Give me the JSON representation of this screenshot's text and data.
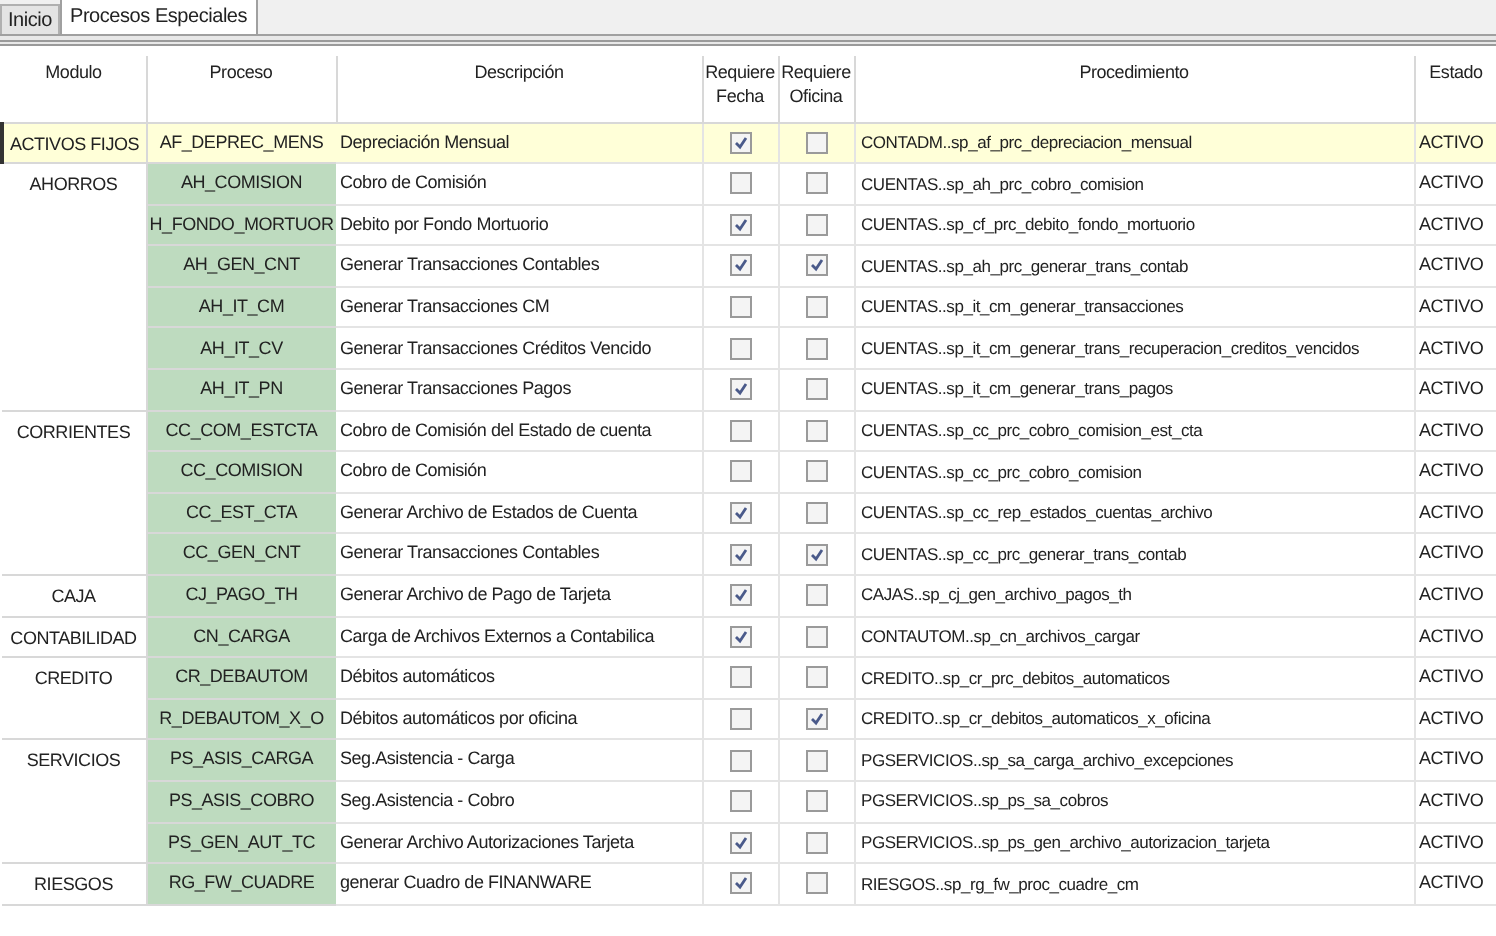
{
  "tabs": [
    {
      "label": "Inicio",
      "selected": false
    },
    {
      "label": "Procesos Especiales",
      "selected": true
    }
  ],
  "table": {
    "columns": [
      "Modulo",
      "Proceso",
      "Descripción",
      "Requiere Fecha",
      "Requiere Oficina",
      "Procedimiento",
      "Estado"
    ],
    "groups": [
      {
        "modulo": "ACTIVOS FIJOS",
        "rows": [
          {
            "proceso": "AF_DEPREC_MENS",
            "descripcion": "Depreciación Mensual",
            "fecha": true,
            "oficina": false,
            "procedimiento": "CONTADM..sp_af_prc_depreciacion_mensual",
            "estado": "ACTIVO",
            "selected": true
          }
        ]
      },
      {
        "modulo": "AHORROS",
        "rows": [
          {
            "proceso": "AH_COMISION",
            "descripcion": "Cobro de Comisión",
            "fecha": false,
            "oficina": false,
            "procedimiento": "CUENTAS..sp_ah_prc_cobro_comision",
            "estado": "ACTIVO",
            "selected": false
          },
          {
            "proceso": "H_FONDO_MORTUOR",
            "descripcion": "Debito por Fondo Mortuorio",
            "fecha": true,
            "oficina": false,
            "procedimiento": "CUENTAS..sp_cf_prc_debito_fondo_mortuorio",
            "estado": "ACTIVO",
            "selected": false
          },
          {
            "proceso": "AH_GEN_CNT",
            "descripcion": "Generar Transacciones Contables",
            "fecha": true,
            "oficina": true,
            "procedimiento": "CUENTAS..sp_ah_prc_generar_trans_contab",
            "estado": "ACTIVO",
            "selected": false
          },
          {
            "proceso": "AH_IT_CM",
            "descripcion": "Generar Transacciones CM",
            "fecha": false,
            "oficina": false,
            "procedimiento": "CUENTAS..sp_it_cm_generar_transacciones",
            "estado": "ACTIVO",
            "selected": false
          },
          {
            "proceso": "AH_IT_CV",
            "descripcion": "Generar Transacciones Créditos Vencido",
            "fecha": false,
            "oficina": false,
            "procedimiento": "CUENTAS..sp_it_cm_generar_trans_recuperacion_creditos_vencidos",
            "estado": "ACTIVO",
            "selected": false
          },
          {
            "proceso": "AH_IT_PN",
            "descripcion": "Generar Transacciones Pagos",
            "fecha": true,
            "oficina": false,
            "procedimiento": "CUENTAS..sp_it_cm_generar_trans_pagos",
            "estado": "ACTIVO",
            "selected": false
          }
        ]
      },
      {
        "modulo": "CORRIENTES",
        "rows": [
          {
            "proceso": "CC_COM_ESTCTA",
            "descripcion": "Cobro de Comisión del Estado de cuenta",
            "fecha": false,
            "oficina": false,
            "procedimiento": "CUENTAS..sp_cc_prc_cobro_comision_est_cta",
            "estado": "ACTIVO",
            "selected": false
          },
          {
            "proceso": "CC_COMISION",
            "descripcion": "Cobro de Comisión",
            "fecha": false,
            "oficina": false,
            "procedimiento": "CUENTAS..sp_cc_prc_cobro_comision",
            "estado": "ACTIVO",
            "selected": false
          },
          {
            "proceso": "CC_EST_CTA",
            "descripcion": "Generar Archivo de Estados de Cuenta",
            "fecha": true,
            "oficina": false,
            "procedimiento": "CUENTAS..sp_cc_rep_estados_cuentas_archivo",
            "estado": "ACTIVO",
            "selected": false
          },
          {
            "proceso": "CC_GEN_CNT",
            "descripcion": "Generar Transacciones Contables",
            "fecha": true,
            "oficina": true,
            "procedimiento": "CUENTAS..sp_cc_prc_generar_trans_contab",
            "estado": "ACTIVO",
            "selected": false
          }
        ]
      },
      {
        "modulo": "CAJA",
        "rows": [
          {
            "proceso": "CJ_PAGO_TH",
            "descripcion": "Generar Archivo de Pago de Tarjeta",
            "fecha": true,
            "oficina": false,
            "procedimiento": "CAJAS..sp_cj_gen_archivo_pagos_th",
            "estado": "ACTIVO",
            "selected": false
          }
        ]
      },
      {
        "modulo": "CONTABILIDAD",
        "rows": [
          {
            "proceso": "CN_CARGA",
            "descripcion": "Carga de Archivos Externos a Contabilica",
            "fecha": true,
            "oficina": false,
            "procedimiento": "CONTAUTOM..sp_cn_archivos_cargar",
            "estado": "ACTIVO",
            "selected": false
          }
        ]
      },
      {
        "modulo": "CREDITO",
        "rows": [
          {
            "proceso": "CR_DEBAUTOM",
            "descripcion": "Débitos automáticos",
            "fecha": false,
            "oficina": false,
            "procedimiento": "CREDITO..sp_cr_prc_debitos_automaticos",
            "estado": "ACTIVO",
            "selected": false
          },
          {
            "proceso": "R_DEBAUTOM_X_O",
            "descripcion": "Débitos automáticos por oficina",
            "fecha": false,
            "oficina": true,
            "procedimiento": "CREDITO..sp_cr_debitos_automaticos_x_oficina",
            "estado": "ACTIVO",
            "selected": false
          }
        ]
      },
      {
        "modulo": "SERVICIOS",
        "rows": [
          {
            "proceso": "PS_ASIS_CARGA",
            "descripcion": "Seg.Asistencia - Carga",
            "fecha": false,
            "oficina": false,
            "procedimiento": "PGSERVICIOS..sp_sa_carga_archivo_excepciones",
            "estado": "ACTIVO",
            "selected": false
          },
          {
            "proceso": "PS_ASIS_COBRO",
            "descripcion": "Seg.Asistencia - Cobro",
            "fecha": false,
            "oficina": false,
            "procedimiento": "PGSERVICIOS..sp_ps_sa_cobros",
            "estado": "ACTIVO",
            "selected": false
          },
          {
            "proceso": "PS_GEN_AUT_TC",
            "descripcion": "Generar Archivo Autorizaciones Tarjeta",
            "fecha": true,
            "oficina": false,
            "procedimiento": "PGSERVICIOS..sp_ps_gen_archivo_autorizacion_tarjeta",
            "estado": "ACTIVO",
            "selected": false
          }
        ]
      },
      {
        "modulo": "RIESGOS",
        "rows": [
          {
            "proceso": "RG_FW_CUADRE",
            "descripcion": "generar Cuadro de FINANWARE",
            "fecha": true,
            "oficina": false,
            "procedimiento": "RIESGOS..sp_rg_fw_proc_cuadre_cm",
            "estado": "ACTIVO",
            "selected": false
          }
        ]
      }
    ]
  }
}
